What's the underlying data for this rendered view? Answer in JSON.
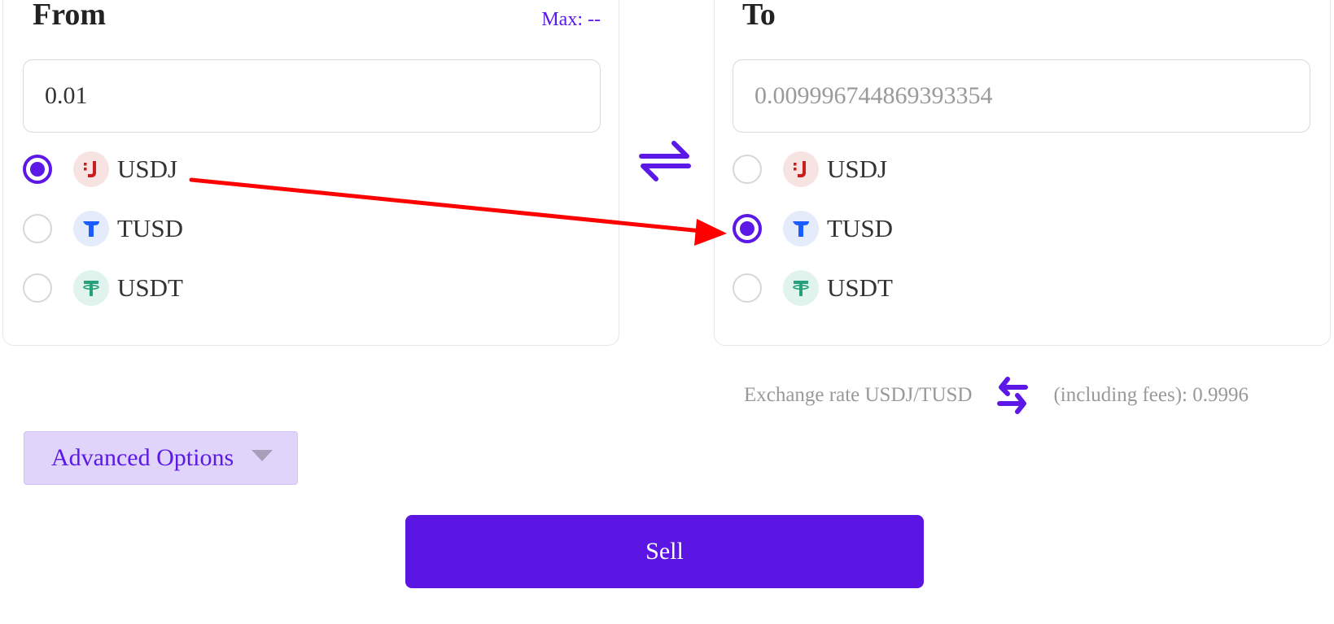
{
  "from_panel": {
    "title": "From",
    "max_label": "Max: --",
    "amount_value": "0.01",
    "options": [
      {
        "label": "USDJ",
        "icon": "usdj-icon",
        "selected": true
      },
      {
        "label": "TUSD",
        "icon": "tusd-icon",
        "selected": false
      },
      {
        "label": "USDT",
        "icon": "usdt-icon",
        "selected": false
      }
    ]
  },
  "to_panel": {
    "title": "To",
    "amount_placeholder": "0.009996744869393354",
    "options": [
      {
        "label": "USDJ",
        "icon": "usdj-icon",
        "selected": false
      },
      {
        "label": "TUSD",
        "icon": "tusd-icon",
        "selected": true
      },
      {
        "label": "USDT",
        "icon": "usdt-icon",
        "selected": false
      }
    ]
  },
  "exchange_rate": {
    "prefix": "Exchange rate USDJ/TUSD",
    "suffix": "(including fees): 0.9996"
  },
  "advanced_options_label": "Advanced Options",
  "sell_label": "Sell",
  "colors": {
    "accent": "#5b18e6",
    "annotation": "#ff0000",
    "usdj": "#c81e1e",
    "tusd": "#1a5cff",
    "usdt": "#26a17b"
  }
}
